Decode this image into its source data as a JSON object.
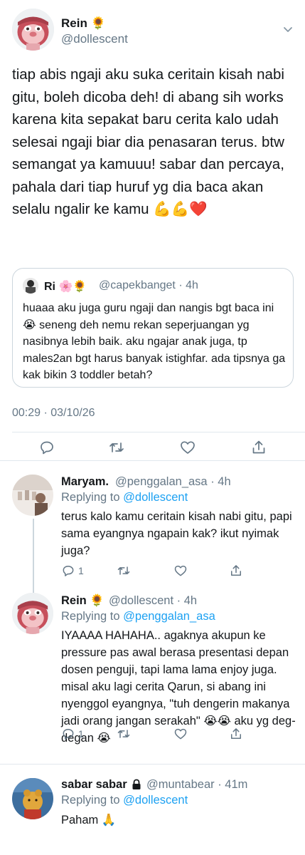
{
  "main_tweet": {
    "name": "Rein 🌻",
    "handle": "@dollescent",
    "text": "tiap abis ngaji aku suka ceritain kisah nabi gitu, boleh dicoba deh! di abang sih works karena kita sepakat baru cerita kalo udah selesai ngaji biar dia penasaran terus. btw semangat ya kamuuu! sabar dan percaya, pahala dari tiap huruf yg dia baca akan selalu ngalir ke kamu 💪💪❤️",
    "timestamp": "00:29 · 03/10/26",
    "quoted": {
      "name": "Ri 🌸🌻",
      "handle": "@capekbanget · 4h",
      "text": "huaaa aku juga guru ngaji dan nangis bgt baca ini 😭 seneng deh nemu rekan seperjuangan yg nasibnya lebih baik. aku ngajar anak juga, tp males2an bgt harus banyak istighfar. ada tipsnya ga kak bikin 3 toddler betah?"
    }
  },
  "replies": [
    {
      "name": "Maryam.",
      "handle": "@penggalan_asa · 4h",
      "replying_prefix": "Replying to ",
      "replying_to": "@dollescent",
      "text": "terus kalo kamu ceritain kisah nabi gitu, papi sama eyangnya ngapain kak? ikut nyimak juga?",
      "reply_count": "1"
    },
    {
      "name": "Rein 🌻",
      "handle": "@dollescent · 4h",
      "replying_prefix": "Replying to ",
      "replying_to": "@penggalan_asa",
      "text": "IYAAAA HAHAHA.. agaknya akupun ke pressure pas awal berasa presentasi depan dosen penguji, tapi lama lama enjoy juga. misal aku lagi cerita Qarun, si abang ini nyenggol eyangnya, \"tuh dengerin makanya jadi orang jangan serakah\" 😭😭 aku yg deg-degan 😭",
      "reply_count": "1"
    },
    {
      "name": "sabar sabar",
      "handle": "@muntabear · 41m",
      "replying_prefix": "Replying to ",
      "replying_to": "@dollescent",
      "text": "Paham 🙏"
    }
  ],
  "colors": {
    "text": "#14171a",
    "secondary": "#657786",
    "link": "#1da1f2",
    "border": "#e1e8ed"
  }
}
